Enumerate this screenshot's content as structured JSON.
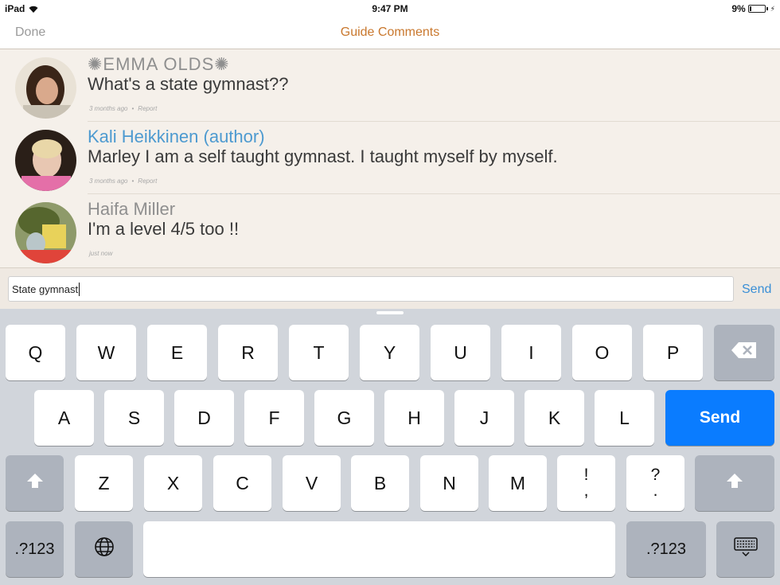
{
  "status_bar": {
    "device": "iPad",
    "time": "9:47 PM",
    "battery_text": "9%",
    "battery_level": 0.09
  },
  "nav": {
    "done_label": "Done",
    "title": "Guide Comments"
  },
  "comments": [
    {
      "name": "✺EMMA OLDS✺",
      "text": "What's a state gymnast??",
      "time": "3 months ago",
      "report": "Report",
      "avatar": "user-avatar"
    },
    {
      "name": "Kali Heikkinen (author)",
      "text": "Marley I am a self taught gymnast.  I taught myself by myself.",
      "time": "3 months ago",
      "report": "Report",
      "avatar": "author-avatar"
    },
    {
      "name": "Haifa Miller",
      "text": "I'm a level 4/5 too !!",
      "time": "just now",
      "avatar": "user-avatar"
    }
  ],
  "composer": {
    "value": "State gymnast",
    "send_label": "Send"
  },
  "keyboard": {
    "row1": [
      "Q",
      "W",
      "E",
      "R",
      "T",
      "Y",
      "U",
      "I",
      "O",
      "P"
    ],
    "row2": [
      "A",
      "S",
      "D",
      "F",
      "G",
      "H",
      "J",
      "K",
      "L"
    ],
    "row3": [
      "Z",
      "X",
      "C",
      "V",
      "B",
      "N",
      "M"
    ],
    "exclaim_top": "!",
    "exclaim_bottom": ",",
    "question_top": "?",
    "question_bottom": ".",
    "send_label": "Send",
    "numbers_label": ".?123",
    "icons": {
      "backspace": "backspace-icon",
      "shift": "shift-icon",
      "globe": "globe-icon",
      "dismiss": "keyboard-dismiss-icon"
    }
  },
  "colors": {
    "title_accent": "#c9782e",
    "author_name": "#4d9ad0",
    "send_key": "#0a7cff",
    "send_link": "#3a8fd6"
  }
}
